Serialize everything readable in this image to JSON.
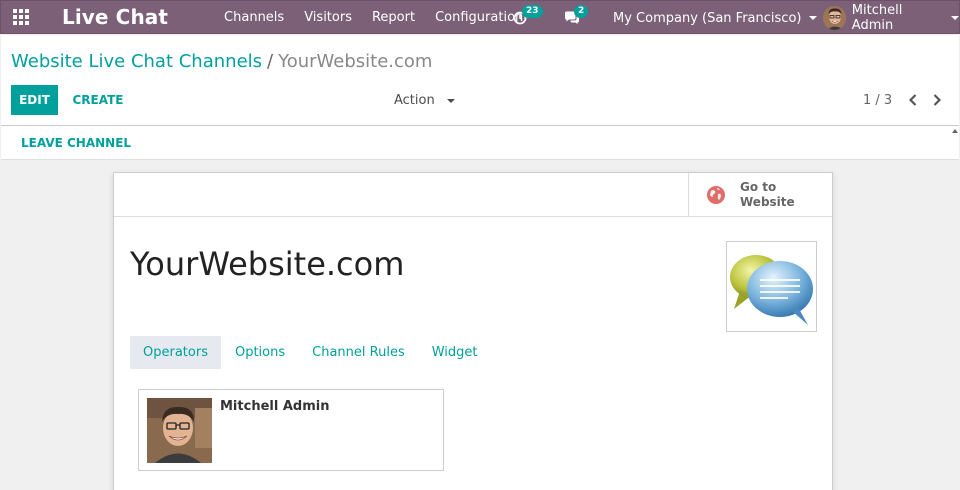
{
  "navbar": {
    "brand": "Live Chat",
    "menu": [
      "Channels",
      "Visitors",
      "Report",
      "Configuration"
    ],
    "activity_count": "23",
    "messages_count": "2",
    "company": "My Company (San Francisco)",
    "user": "Mitchell Admin",
    "bg_color": "#7c6078"
  },
  "breadcrumb": {
    "parent": "Website Live Chat Channels",
    "separator": "/",
    "current": "YourWebsite.com"
  },
  "toolbar": {
    "edit": "EDIT",
    "create": "CREATE",
    "action": "Action",
    "pager": "1 / 3"
  },
  "statusbar": {
    "leave": "LEAVE CHANNEL"
  },
  "sheet": {
    "goto_line1": "Go to",
    "goto_line2": "Website",
    "title": "YourWebsite.com",
    "tabs": [
      "Operators",
      "Options",
      "Channel Rules",
      "Widget"
    ],
    "active_tab": "Operators",
    "operator": "Mitchell Admin"
  },
  "colors": {
    "accent": "#00a09d",
    "navbar": "#7c6078"
  }
}
